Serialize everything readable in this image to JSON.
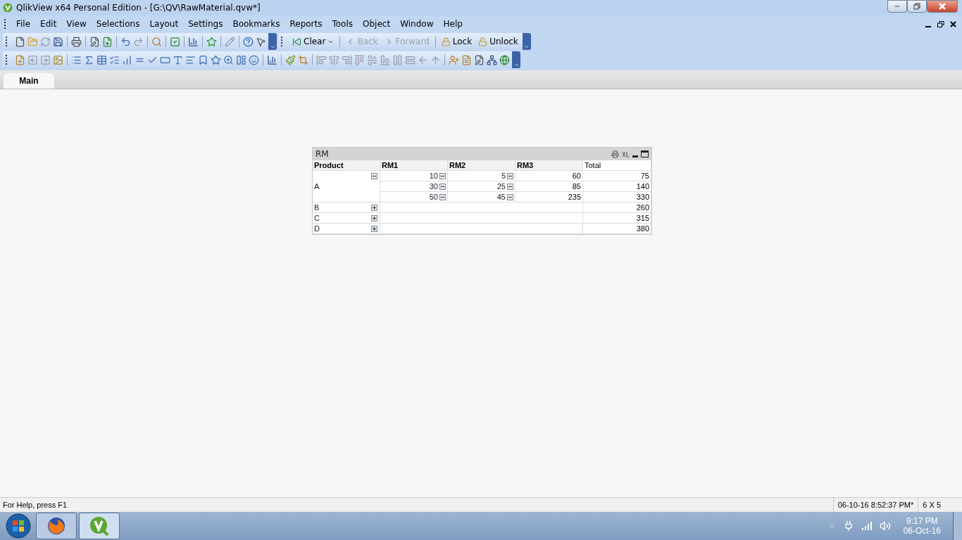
{
  "window": {
    "title": "QlikView x64 Personal Edition - [G:\\QV\\RawMaterial.qvw*]"
  },
  "menu": [
    "File",
    "Edit",
    "View",
    "Selections",
    "Layout",
    "Settings",
    "Bookmarks",
    "Reports",
    "Tools",
    "Object",
    "Window",
    "Help"
  ],
  "selection_toolbar": [
    {
      "label": "Clear",
      "disabled": false,
      "kind": "clear"
    },
    {
      "label": "Back",
      "disabled": true,
      "kind": "back"
    },
    {
      "label": "Forward",
      "disabled": true,
      "kind": "forward"
    },
    {
      "label": "Lock",
      "disabled": false,
      "kind": "lock"
    },
    {
      "label": "Unlock",
      "disabled": false,
      "kind": "unlock"
    }
  ],
  "tabs": [
    {
      "label": "Main",
      "selected": true
    }
  ],
  "table": {
    "title": "RM",
    "columns": [
      "Product",
      "RM1",
      "RM2",
      "RM3",
      "Total"
    ],
    "rows": [
      {
        "product": "A",
        "expanded": true,
        "subrows": [
          {
            "rm1": "10",
            "rm2": "5",
            "rm3": "60",
            "total": "75"
          },
          {
            "rm1": "30",
            "rm2": "25",
            "rm3": "85",
            "total": "140"
          },
          {
            "rm1": "50",
            "rm2": "45",
            "rm3": "235",
            "total": "330"
          }
        ]
      },
      {
        "product": "B",
        "expanded": false,
        "total": "260"
      },
      {
        "product": "C",
        "expanded": false,
        "total": "315"
      },
      {
        "product": "D",
        "expanded": false,
        "total": "380"
      }
    ]
  },
  "status_bar": {
    "help": "For Help, press F1",
    "timestamp": "06-10-16 8:52:37 PM*",
    "size": "6 X 5"
  },
  "taskbar": {
    "time": "9:17 PM",
    "date": "06-Oct-16"
  }
}
